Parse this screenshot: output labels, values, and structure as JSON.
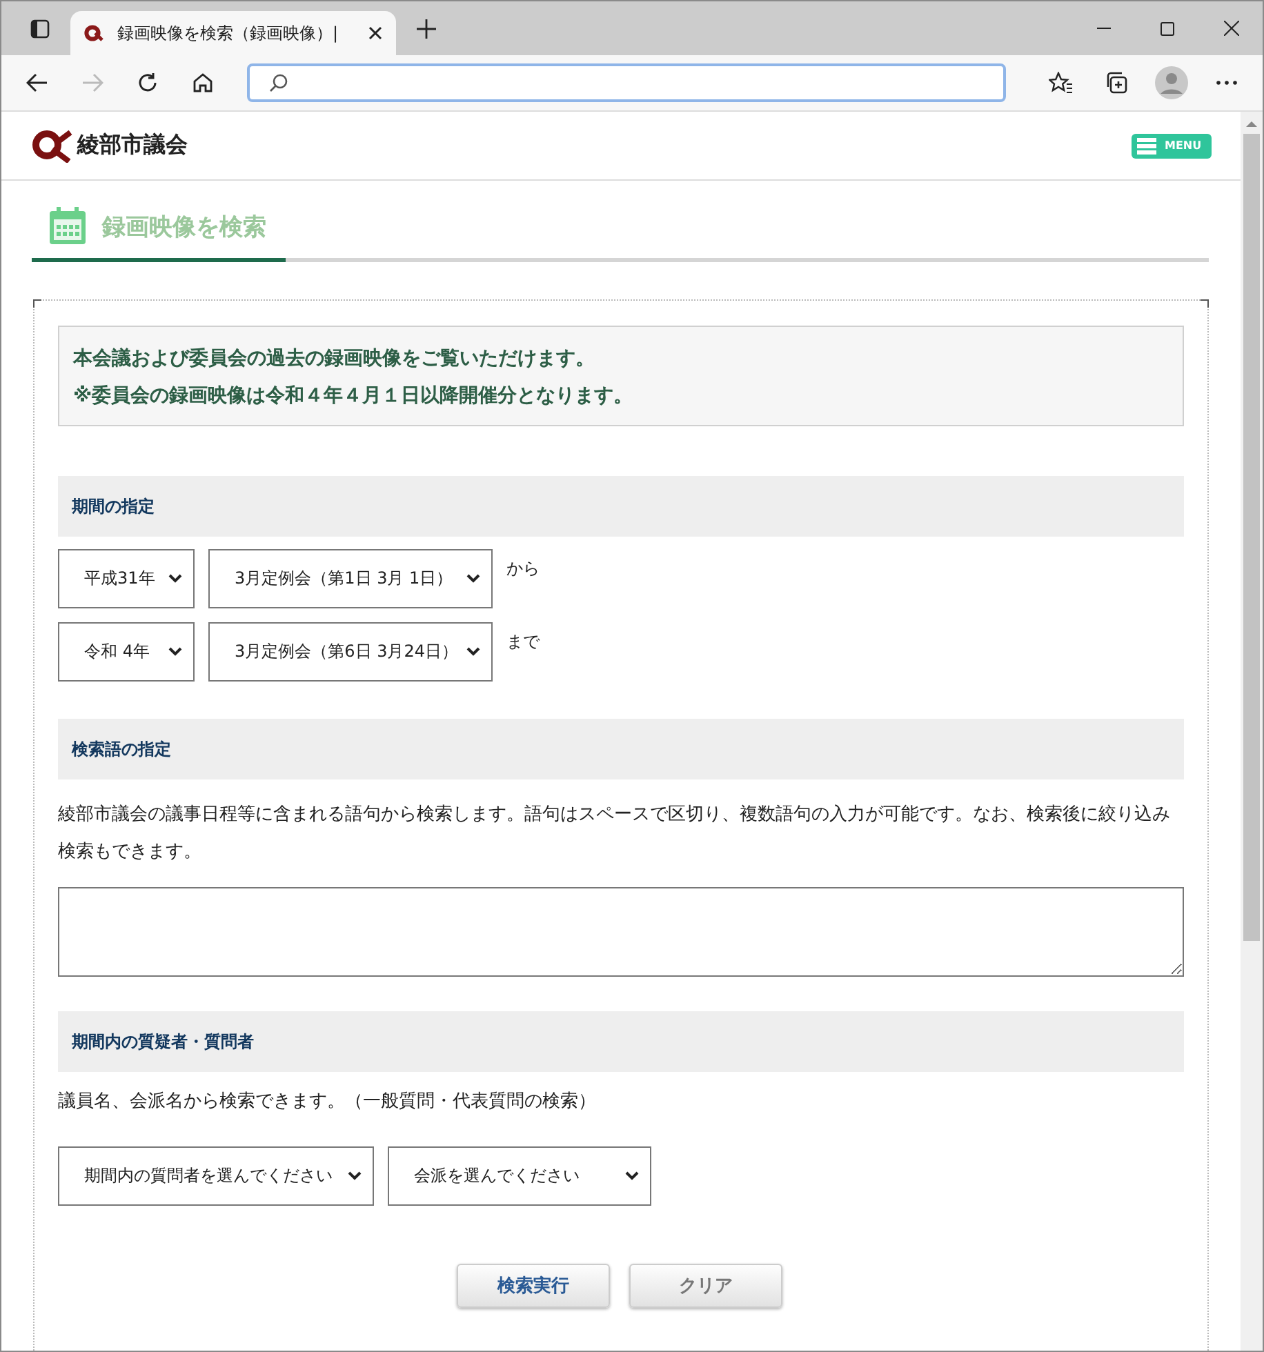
{
  "browser": {
    "tab_title": "録画映像を検索（録画映像）|"
  },
  "site": {
    "name": "綾部市議会",
    "menu_label": "MENU"
  },
  "page_title": "録画映像を検索",
  "notice": [
    "本会議および委員会の過去の録画映像をご覧いただけます。",
    "※委員会の録画映像は令和４年４月１日以降開催分となります。"
  ],
  "period": {
    "heading": "期間の指定",
    "rows": [
      {
        "era": "平成31年",
        "session": "3月定例会（第1日 3月 1日）",
        "suffix": "から"
      },
      {
        "era": "令和 4年",
        "session": "3月定例会（第6日 3月24日）",
        "suffix": "まで"
      }
    ]
  },
  "keyword": {
    "heading": "検索語の指定",
    "description": "綾部市議会の議事日程等に含まれる語句から検索します。語句はスペースで区切り、複数語句の入力が可能です。なお、検索後に絞り込み検索もできます。"
  },
  "questioner": {
    "heading": "期間内の質疑者・質問者",
    "description": "議員名、会派名から検索できます。（一般質問・代表質問の検索）",
    "selects": [
      "期間内の質問者を選んでください",
      "会派を選んでください"
    ]
  },
  "buttons": [
    {
      "label": "検索実行",
      "kind": "primary"
    },
    {
      "label": "クリア",
      "kind": "secondary"
    }
  ]
}
